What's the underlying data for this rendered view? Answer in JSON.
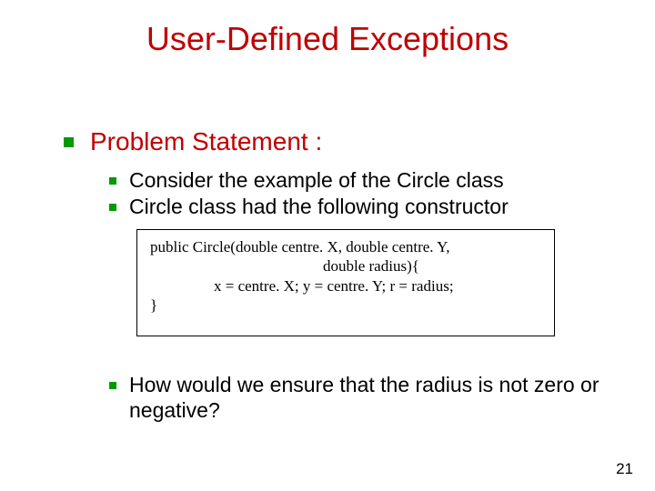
{
  "title": "User-Defined Exceptions",
  "section": {
    "heading": "Problem Statement :",
    "points": [
      "Consider the example of the Circle class",
      "Circle class had the following  constructor"
    ],
    "followup": "How would we ensure that the radius is not zero or negative?"
  },
  "code": {
    "line1": "public Circle(double centre. X, double centre. Y,",
    "line2": "double radius){",
    "line3": "x  = centre. X; y = centre. Y;  r = radius;",
    "line4": "}"
  },
  "page_number": "21"
}
